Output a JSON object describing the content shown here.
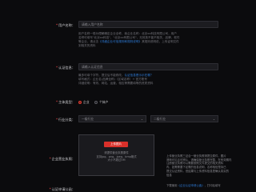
{
  "user_name": {
    "label": "用户名称",
    "placeholder": "请输入用户名称",
    "help_1": "用户名称一般为理解确定企业全称，我企业名称：北京xx科技有限公司，用户",
    "help_2": "名称可填写\"北京xx科技\"，\"北京xx有限公司\"，无效英不能不相关、品牌、软件",
    "help_3": "等企业，请点击",
    "help_link": "《详细企业可信规则和规则说明》",
    "help_4": "其规则说明说，上传证明文件",
    "help_5": "到相关的资料"
  },
  "cert_info": {
    "label": "认证信息",
    "placeholder": "请输入认证信息",
    "help_1": "最多可填个字符，提交后不能修改，",
    "help_link": "认证信息是示示在哪？",
    "help_2": "填写格式：企业名(品牌全称)（区域名称）+ 官方账号",
    "help_3": "详细说明：有则、网站、运营、相应等需要填等的资质资料"
  },
  "subject_type": {
    "label": "主体类型",
    "options": [
      "企业",
      "个体户"
    ],
    "selected": "企业"
  },
  "industry": {
    "label": "行业分类",
    "primary_placeholder": "一级行业",
    "secondary_placeholder": "二级行业"
  },
  "license": {
    "label": "企业营业执照",
    "upload_button": "上传图片",
    "upload_hint_1": "请提供营业执照原件",
    "upload_hint_2": "支持jpg、png、jpeg、bmp格式",
    "upload_hint_3": "大小不超过5M",
    "side_help_1": "上传营业执照三证合一营业执照请提交原件，图片",
    "side_help_2": "清晰可见且可辨认，请确保营业执照完整，在有效期内",
    "side_help_3": "注册营业执照可以需要按照文件提交的相关资料",
    "side_help_4": "内、如需需要下足需的信息说明，名称相信是持已",
    "side_help_5": "提交认证资料，但结果与上传资料信息是确认真实的",
    "side_help_6": "信息"
  },
  "cert_letter": {
    "label": "认证申请公函",
    "side_help_1": "下载使用",
    "side_help_link": "《企业认证申请公函》",
    "side_help_2": "，打印后填写"
  },
  "colors": {
    "background": "#0b0b0d",
    "accent": "#d9302a",
    "link": "#2e7bd6"
  }
}
